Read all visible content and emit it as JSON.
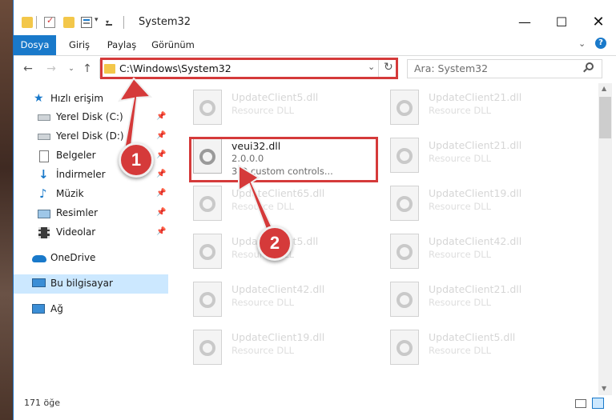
{
  "window": {
    "title": "System32"
  },
  "ribbon": {
    "tabs": [
      "Dosya",
      "Giriş",
      "Paylaş",
      "Görünüm"
    ]
  },
  "address": {
    "path": "C:\\Windows\\System32"
  },
  "search": {
    "placeholder": "Ara: System32"
  },
  "sidebar": {
    "quick_access": "Hızlı erişim",
    "items": [
      {
        "label": "Yerel Disk (C:)"
      },
      {
        "label": "Yerel Disk (D:)"
      },
      {
        "label": "Belgeler"
      },
      {
        "label": "İndirmeler"
      },
      {
        "label": "Müzik"
      },
      {
        "label": "Resimler"
      },
      {
        "label": "Videolar"
      }
    ],
    "onedrive": "OneDrive",
    "this_pc": "Bu bilgisayar",
    "network": "Ağ"
  },
  "files": {
    "col1": [
      {
        "name": "UpdateClient5.dll",
        "desc": "Resource DLL"
      },
      {
        "name": "veui32.dll",
        "version": "2.0.0.0",
        "desc": "3-D custom controls..."
      },
      {
        "name": "UpdateClient65.dll",
        "desc": "Resource DLL"
      },
      {
        "name": "UpdateClient5.dll",
        "desc": "Resource DLL"
      },
      {
        "name": "UpdateClient42.dll",
        "desc": "Resource DLL"
      },
      {
        "name": "UpdateClient19.dll",
        "desc": "Resource DLL"
      }
    ],
    "col2": [
      {
        "name": "UpdateClient21.dll",
        "desc": "Resource DLL"
      },
      {
        "name": "UpdateClient21.dll",
        "desc": "Resource DLL"
      },
      {
        "name": "UpdateClient19.dll",
        "desc": "Resource DLL"
      },
      {
        "name": "UpdateClient42.dll",
        "desc": "Resource DLL"
      },
      {
        "name": "UpdateClient21.dll",
        "desc": "Resource DLL"
      },
      {
        "name": "UpdateClient5.dll",
        "desc": "Resource DLL"
      }
    ]
  },
  "status": {
    "count": "171 öğe"
  },
  "annotations": {
    "step1": "1",
    "step2": "2",
    "color": "#d53a3a"
  }
}
